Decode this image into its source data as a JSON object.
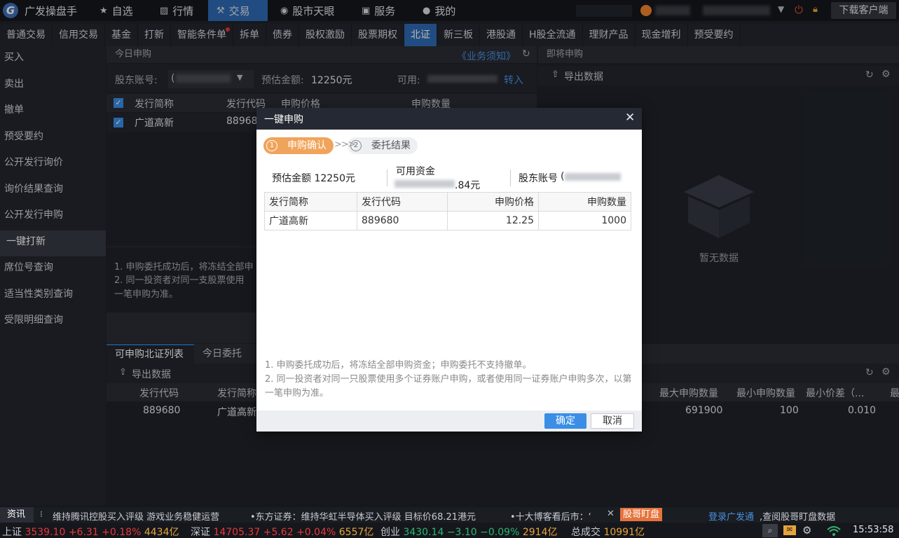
{
  "app": {
    "title": "广发操盘手",
    "logo_letter": "G"
  },
  "topnav": [
    {
      "label": "自选",
      "icon": "star-icon"
    },
    {
      "label": "行情",
      "icon": "chart-icon"
    },
    {
      "label": "交易",
      "icon": "hammer-icon",
      "active": true
    },
    {
      "label": "股市天眼",
      "icon": "eye-icon"
    },
    {
      "label": "服务",
      "icon": "briefcase-icon"
    },
    {
      "label": "我的",
      "icon": "user-icon"
    }
  ],
  "download_button": "下载客户端",
  "tabs": [
    "普通交易",
    "信用交易",
    "基金",
    "打新",
    "智能条件单",
    "拆单",
    "债券",
    "股权激励",
    "股票期权",
    "北证",
    "新三板",
    "港股通",
    "H股全流通",
    "理财产品",
    "现金增利",
    "预受要约"
  ],
  "active_tab": "北证",
  "sidebar": [
    "买入",
    "卖出",
    "撤单",
    "预受要约",
    "公开发行询价",
    "询价结果查询",
    "公开发行申购",
    "一键打新",
    "席位号查询",
    "适当性类别查询",
    "受限明细查询"
  ],
  "active_side": "一键打新",
  "today_panel": {
    "title": "今日申购",
    "notice_link": "《业务须知》",
    "account_label": "股东账号:",
    "account_value_prefix": "(",
    "estimate_label": "预估金额:",
    "estimate_value": "12250元",
    "available_label": "可用:",
    "transfer_link": "转入",
    "columns": [
      "发行简称",
      "发行代码",
      "申购价格",
      "申购数量"
    ],
    "row": {
      "name": "广道高新",
      "code": "88968"
    },
    "notes": [
      "1. 申购委托成功后，将冻结全部申",
      "2. 同一投资者对同一支股票使用",
      "一笔申购为准。"
    ]
  },
  "upcoming_panel": {
    "title": "即将申购",
    "export": "导出数据",
    "empty": "暂无数据"
  },
  "bottom_panel": {
    "tabs": [
      "可申购北证列表",
      "今日委托"
    ],
    "export": "导出数据",
    "columns": [
      "发行代码",
      "发行简称",
      "最大申购数量",
      "最小申购数量",
      "最小价差（...",
      "最"
    ],
    "row": {
      "code": "889680",
      "name": "广道高新",
      "max": "691900",
      "min": "100",
      "tick": "0.010"
    }
  },
  "modal": {
    "title": "一键申购",
    "step1_num": "1",
    "step1": "申购确认",
    "step_arrows": ">>>",
    "step2_num": "2",
    "step2": "委托结果",
    "estimate": "预估金额 12250元",
    "available_label": "可用资金",
    "available_suffix": ".84元",
    "account_label": "股东账号",
    "account_prefix": "(",
    "table_head": [
      "发行简称",
      "发行代码",
      "申购价格",
      "申购数量"
    ],
    "table_row": [
      "广道高新",
      "889680",
      "12.25",
      "1000"
    ],
    "notes": [
      "1. 申购委托成功后，将冻结全部申购资金；申购委托不支持撤单。",
      "2. 同一投资者对同一只股票使用多个证券账户申购，或者使用同一证券账户申购多次，以第一笔申购为准。"
    ],
    "ok": "确定",
    "cancel": "取消"
  },
  "news": {
    "label": "资讯",
    "items": [
      "维持腾讯控股买入评级 游戏业务稳健运营",
      "•东方证券：维持华虹半导体买入评级 目标价68.21港元",
      "•十大博客看后市：‘"
    ],
    "badge": "股哥盯盘",
    "login_link": "登录广发通",
    "login_text": ",查阅股哥盯盘数据"
  },
  "quotes": {
    "sh": {
      "name": "上证",
      "price": "3539.10",
      "chg": "+6.31",
      "pct": "+0.18%",
      "vol": "4434亿"
    },
    "sz": {
      "name": "深证",
      "price": "14705.37",
      "chg": "+5.62",
      "pct": "+0.04%",
      "vol": "6557亿"
    },
    "cy": {
      "name": "创业",
      "price": "3430.14",
      "chg": "−3.10",
      "pct": "−0.09%",
      "vol": "2914亿"
    },
    "total_label": "总成交",
    "total": "10991亿",
    "time": "15:53:58"
  },
  "colors": {
    "accent": "#2f6ab3",
    "step": "#f0a45b",
    "ok": "#3a8ee6",
    "up": "#e4393c",
    "down": "#2bb673"
  }
}
